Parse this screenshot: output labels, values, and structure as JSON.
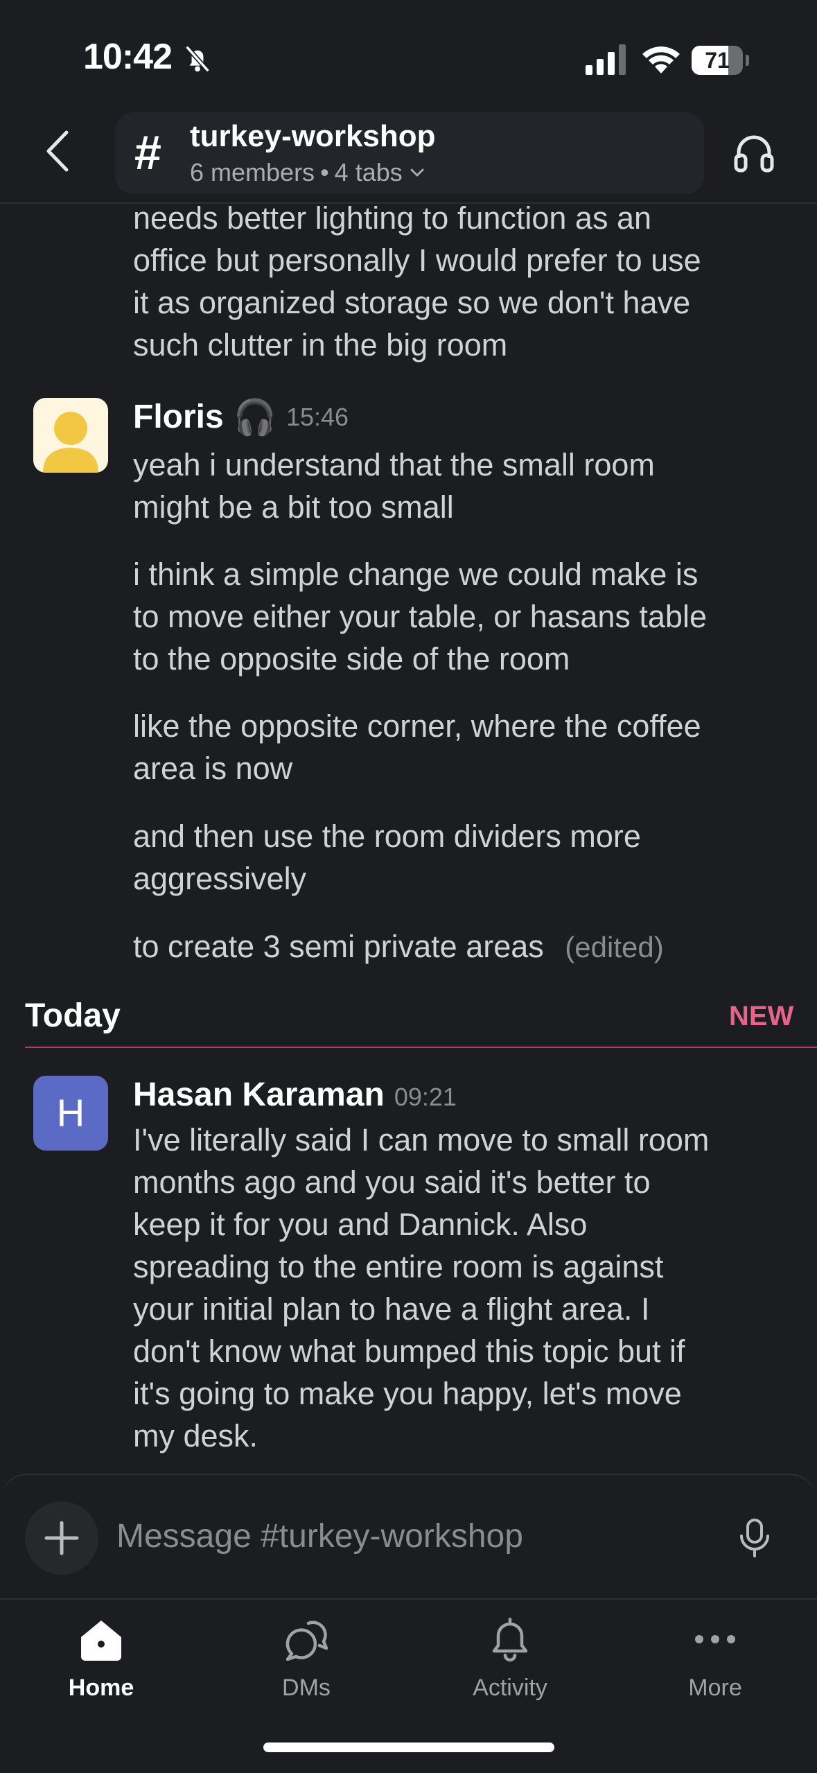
{
  "status_bar": {
    "time": "10:42",
    "battery": "71",
    "battery_level": 0.71
  },
  "header": {
    "channel_name": "turkey-workshop",
    "members": "6 members",
    "separator": "•",
    "tabs": "4 tabs"
  },
  "messages": {
    "continued_lines": [
      "needs better lighting to function as an",
      "office but personally I would prefer to use",
      "it as organized storage so we don't have",
      "such clutter in the big room"
    ],
    "floris": {
      "author": "Floris",
      "status_emoji": "🎧",
      "time": "15:46",
      "p1": [
        "yeah i understand that the small room",
        "might be a bit too small"
      ],
      "p2": [
        "i think a simple change we could make is",
        "to move either your table, or hasans table",
        "to the opposite side of the room"
      ],
      "p3": [
        "like the opposite corner, where the coffee",
        "area is now"
      ],
      "p4": [
        "and then use the room dividers more",
        "aggressively"
      ],
      "p5": "to create 3 semi private areas",
      "edited": "(edited)"
    },
    "divider": {
      "label": "Today",
      "new": "NEW"
    },
    "hasan": {
      "avatar_letter": "H",
      "author": "Hasan Karaman",
      "time": "09:21",
      "lines": [
        "I've literally said I can move to small room",
        "months ago and you said it's better to",
        "keep it for you and Dannick. Also",
        "spreading to the entire room is against",
        "your initial plan to have a flight area. I",
        "don't know what bumped this topic but if",
        "it's going to make you happy, let's move",
        "my desk."
      ]
    }
  },
  "composer": {
    "placeholder": "Message #turkey-workshop"
  },
  "tabbar": {
    "home": "Home",
    "dms": "DMs",
    "activity": "Activity",
    "more": "More"
  },
  "colors": {
    "background": "#1b1d21",
    "new_accent": "#e8638a",
    "avatar_h": "#5b6ac4"
  }
}
